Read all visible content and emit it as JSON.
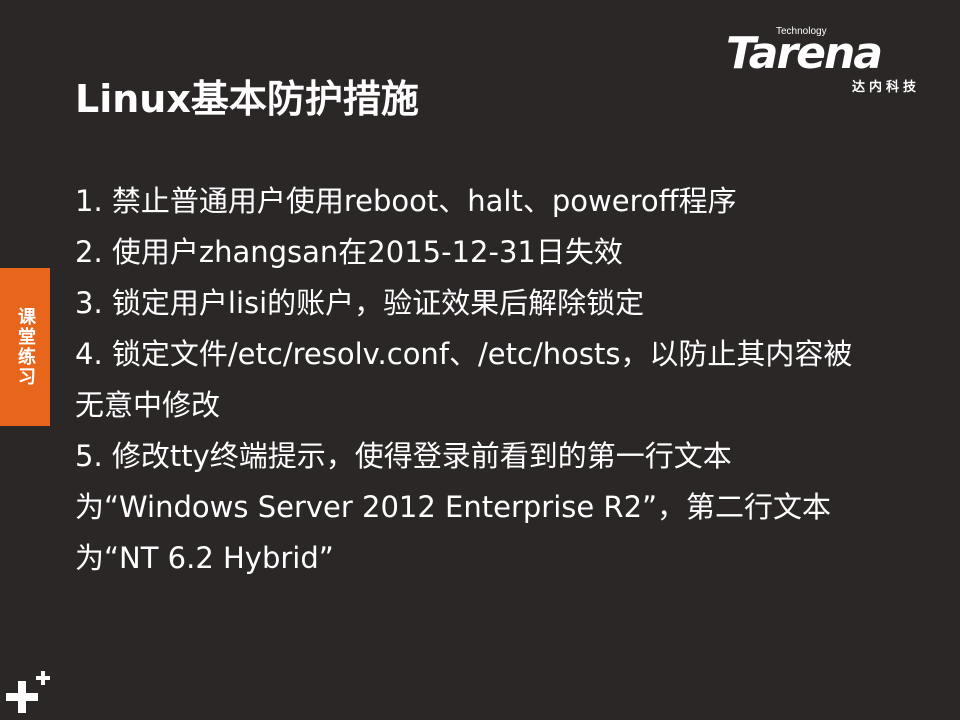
{
  "slide": {
    "title": "Linux基本防护措施",
    "side_tab": "课堂练习",
    "logo": {
      "tagline": "Technology",
      "wordmark": "Tarena",
      "cn_name": "达内科技"
    },
    "items": [
      "1. 禁止普通用户使用reboot、halt、poweroff程序",
      "2. 使用户zhangsan在2015-12-31日失效",
      "3. 锁定用户lisi的账户，验证效果后解除锁定",
      "4. 锁定文件/etc/resolv.conf、/etc/hosts，以防止其内容被无意中修改",
      "5. 修改tty终端提示，使得登录前看到的第一行文本为“Windows Server 2012 Enterprise R2”，第二行文本为“NT 6.2 Hybrid”"
    ],
    "corner_icon": "plus-icon"
  },
  "colors": {
    "background": "#2b2727",
    "accent": "#e8661c",
    "text": "#ffffff"
  }
}
